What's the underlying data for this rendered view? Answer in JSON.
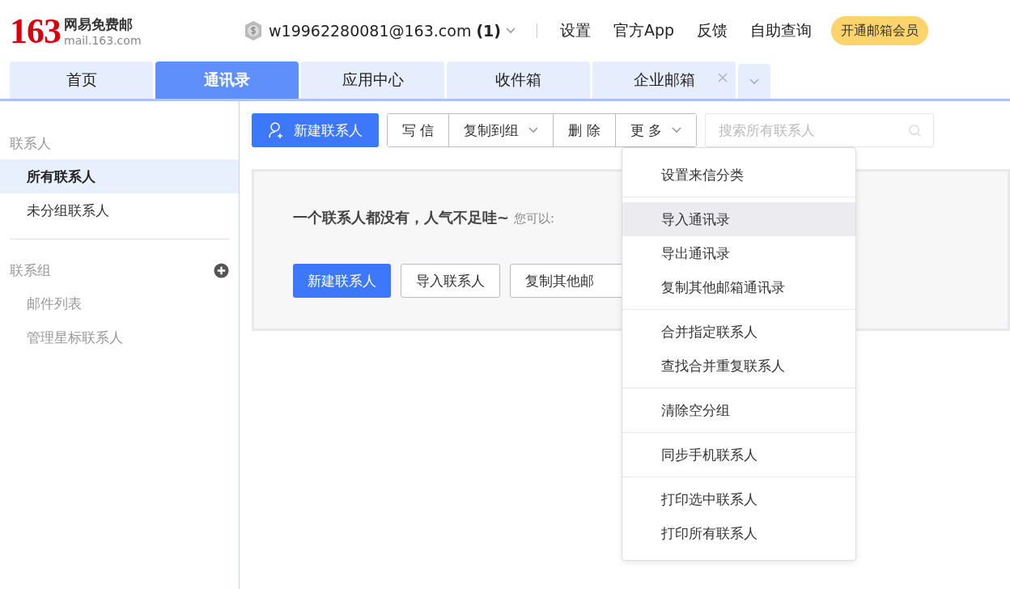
{
  "logo": {
    "number": "163",
    "name": "网易免费邮",
    "domain": "mail.163.com"
  },
  "account": {
    "email": "w19962280081@163.com",
    "count": "(1)"
  },
  "top_links": [
    "设置",
    "官方App",
    "反馈",
    "自助查询"
  ],
  "vip_button": "开通邮箱会员",
  "tabs": [
    {
      "label": "首页",
      "selected": false,
      "closable": false
    },
    {
      "label": "通讯录",
      "selected": true,
      "closable": false
    },
    {
      "label": "应用中心",
      "selected": false,
      "closable": false
    },
    {
      "label": "收件箱",
      "selected": false,
      "closable": false
    },
    {
      "label": "企业邮箱",
      "selected": false,
      "closable": true
    }
  ],
  "sidebar": {
    "sections": [
      {
        "title": "联系人",
        "has_add": false,
        "items": [
          {
            "label": "所有联系人",
            "selected": true
          },
          {
            "label": "未分组联系人",
            "selected": false
          }
        ]
      },
      {
        "title": "联系组",
        "has_add": true,
        "items": [
          {
            "label": "邮件列表",
            "selected": false
          },
          {
            "label": "管理星标联系人",
            "selected": false
          }
        ]
      }
    ]
  },
  "toolbar": {
    "new_contact": "新建联系人",
    "buttons": [
      {
        "label": "写 信",
        "dropdown": false
      },
      {
        "label": "复制到组",
        "dropdown": true
      },
      {
        "label": "删 除",
        "dropdown": false
      },
      {
        "label": "更 多",
        "dropdown": true
      }
    ],
    "search": {
      "placeholder": "搜索所有联系人"
    }
  },
  "empty": {
    "message": "一个联系人都没有，人气不足哇~",
    "hint": "您可以:",
    "buttons": [
      {
        "label": "新建联系人",
        "primary": true
      },
      {
        "label": "导入联系人",
        "primary": false
      },
      {
        "label": "复制其他邮",
        "primary": false
      }
    ]
  },
  "menu": {
    "groups": [
      [
        {
          "label": "设置来信分类",
          "highlighted": false
        }
      ],
      [
        {
          "label": "导入通讯录",
          "highlighted": true
        },
        {
          "label": "导出通讯录",
          "highlighted": false
        },
        {
          "label": "复制其他邮箱通讯录",
          "highlighted": false
        }
      ],
      [
        {
          "label": "合并指定联系人",
          "highlighted": false
        },
        {
          "label": "查找合并重复联系人",
          "highlighted": false
        }
      ],
      [
        {
          "label": "清除空分组",
          "highlighted": false
        }
      ],
      [
        {
          "label": "同步手机联系人",
          "highlighted": false
        }
      ],
      [
        {
          "label": "打印选中联系人",
          "highlighted": false
        },
        {
          "label": "打印所有联系人",
          "highlighted": false
        }
      ]
    ]
  }
}
